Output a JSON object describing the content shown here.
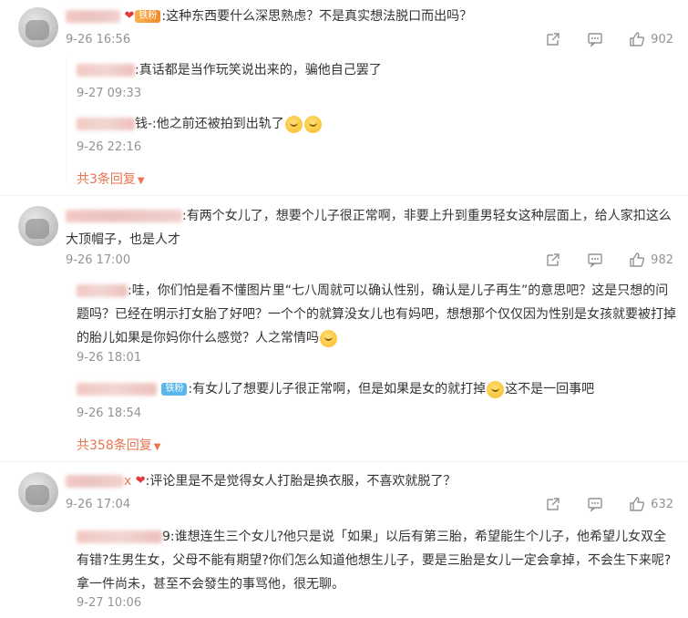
{
  "comments": [
    {
      "badge": "铁粉",
      "text": ":这种东西要什么深思熟虑？不是真实想法脱口而出吗？",
      "time": "9-26 16:56",
      "likes": "902",
      "replies": [
        {
          "text": ":真话都是当作玩笑说出来的，骗他自己罢了",
          "time": "9-27 09:33"
        },
        {
          "text": "钱-:他之前还被拍到出轨了",
          "time": "9-26 22:16"
        }
      ],
      "more": "共3条回复"
    },
    {
      "text": ":有两个女儿了，想要个儿子很正常啊，非要上升到重男轻女这种层面上，给人家扣这么大顶帽子，也是人才",
      "time": "9-26 17:00",
      "likes": "982",
      "replies": [
        {
          "text": ":哇，你们怕是看不懂图片里“七八周就可以确认性别，确认是儿子再生”的意思吧？这是只想的问题吗？已经在明示打女胎了好吧？一个个的就算没女儿也有妈吧，想想那个仅仅因为性别是女孩就要被打掉的胎儿如果是你妈你什么感觉？人之常情吗",
          "time": "9-26 18:01"
        },
        {
          "badge": "铁粉",
          "text": ":有女儿了想要儿子很正常啊，但是如果是女的就打掉",
          "text2": "这不是一回事吧",
          "time": "9-26 18:54"
        }
      ],
      "more": "共358条回复"
    },
    {
      "name_suffix": "x",
      "text": ":评论里是不是觉得女人打胎是换衣服，不喜欢就脱了？",
      "time": "9-26 17:04",
      "likes": "632",
      "replies": [
        {
          "text": "9:谁想连生三个女儿?他只是说「如果」以后有第三胎，希望能生个儿子，他希望儿女双全有错?生男生女，父母不能有期望?你们怎么知道他想生儿子，要是三胎是女儿一定会拿掉，不会生下来呢?拿一件尚未，甚至不会發生的事骂他，很无聊。",
          "time": "9-27 10:06"
        }
      ]
    }
  ],
  "colors": {
    "accent": "#eb7350",
    "meta": "#939393",
    "badge_blue": "#58b6ea",
    "badge_orange": "#f08a2b"
  }
}
